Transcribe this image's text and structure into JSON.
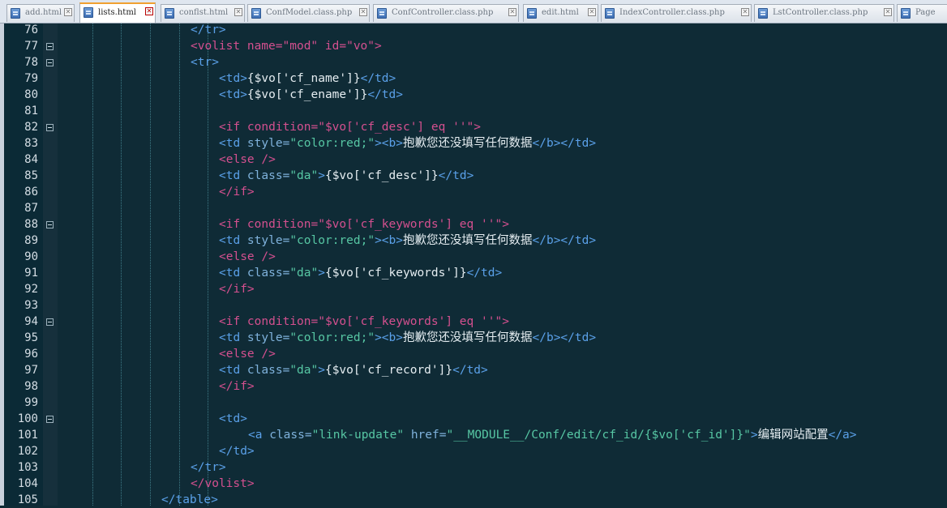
{
  "tabs": [
    {
      "label": "add.html",
      "active": false
    },
    {
      "label": "lists.html",
      "active": true
    },
    {
      "label": "conflst.html",
      "active": false
    },
    {
      "label": "ConfModel.class.php",
      "active": false
    },
    {
      "label": "ConfController.class.php",
      "active": false
    },
    {
      "label": "edit.html",
      "active": false
    },
    {
      "label": "IndexController.class.php",
      "active": false
    },
    {
      "label": "LstController.class.php",
      "active": false
    },
    {
      "label": "Page",
      "active": false
    }
  ],
  "tab_close_glyph": "✕",
  "icons": {
    "tab_file": "html-file-icon",
    "fold": "fold-minus-icon"
  },
  "colors": {
    "editor_bg": "#0f2b36",
    "tag": "#5aa0e8",
    "special_tag": "#d4508f",
    "attribute": "#7fb2dc",
    "string": "#57c7a4",
    "text": "#e5edf1"
  },
  "code_lines": [
    {
      "n": "76",
      "fold": false,
      "indent": 6,
      "tokens": [
        [
          "tag",
          "</tr>"
        ]
      ]
    },
    {
      "n": "77",
      "fold": true,
      "indent": 6,
      "tokens": [
        [
          "special",
          "<volist "
        ],
        [
          "special",
          "name="
        ],
        [
          "special",
          "\"mod\" "
        ],
        [
          "special",
          "id="
        ],
        [
          "special",
          "\"vo\""
        ],
        [
          "special",
          ">"
        ]
      ]
    },
    {
      "n": "78",
      "fold": true,
      "indent": 6,
      "tokens": [
        [
          "tag",
          "<tr>"
        ]
      ]
    },
    {
      "n": "79",
      "fold": false,
      "indent": 7,
      "tokens": [
        [
          "tag",
          "<td>"
        ],
        [
          "text",
          "{$vo['cf_name']}"
        ],
        [
          "tag",
          "</td>"
        ]
      ]
    },
    {
      "n": "80",
      "fold": false,
      "indent": 7,
      "tokens": [
        [
          "tag",
          "<td>"
        ],
        [
          "text",
          "{$vo['cf_ename']}"
        ],
        [
          "tag",
          "</td>"
        ]
      ]
    },
    {
      "n": "81",
      "fold": false,
      "indent": 0,
      "tokens": []
    },
    {
      "n": "82",
      "fold": true,
      "indent": 7,
      "tokens": [
        [
          "special",
          "<if condition=\"$vo['cf_desc'] eq ''\">"
        ]
      ]
    },
    {
      "n": "83",
      "fold": false,
      "indent": 7,
      "tokens": [
        [
          "tag",
          "<td "
        ],
        [
          "attr",
          "style="
        ],
        [
          "str",
          "\"color:red;\""
        ],
        [
          "tag",
          "><b>"
        ],
        [
          "text",
          "抱歉您还没填写任何数据"
        ],
        [
          "tag",
          "</b></td>"
        ]
      ]
    },
    {
      "n": "84",
      "fold": false,
      "indent": 7,
      "tokens": [
        [
          "special",
          "<else />"
        ]
      ]
    },
    {
      "n": "85",
      "fold": false,
      "indent": 7,
      "tokens": [
        [
          "tag",
          "<td "
        ],
        [
          "attr",
          "class="
        ],
        [
          "str",
          "\"da\""
        ],
        [
          "tag",
          ">"
        ],
        [
          "text",
          "{$vo['cf_desc']}"
        ],
        [
          "tag",
          "</td>"
        ]
      ]
    },
    {
      "n": "86",
      "fold": false,
      "indent": 7,
      "tokens": [
        [
          "special",
          "</if>"
        ]
      ]
    },
    {
      "n": "87",
      "fold": false,
      "indent": 0,
      "tokens": []
    },
    {
      "n": "88",
      "fold": true,
      "indent": 7,
      "tokens": [
        [
          "special",
          "<if condition=\"$vo['cf_keywords'] eq ''\">"
        ]
      ]
    },
    {
      "n": "89",
      "fold": false,
      "indent": 7,
      "tokens": [
        [
          "tag",
          "<td "
        ],
        [
          "attr",
          "style="
        ],
        [
          "str",
          "\"color:red;\""
        ],
        [
          "tag",
          "><b>"
        ],
        [
          "text",
          "抱歉您还没填写任何数据"
        ],
        [
          "tag",
          "</b></td>"
        ]
      ]
    },
    {
      "n": "90",
      "fold": false,
      "indent": 7,
      "tokens": [
        [
          "special",
          "<else />"
        ]
      ]
    },
    {
      "n": "91",
      "fold": false,
      "indent": 7,
      "tokens": [
        [
          "tag",
          "<td "
        ],
        [
          "attr",
          "class="
        ],
        [
          "str",
          "\"da\""
        ],
        [
          "tag",
          ">"
        ],
        [
          "text",
          "{$vo['cf_keywords']}"
        ],
        [
          "tag",
          "</td>"
        ]
      ]
    },
    {
      "n": "92",
      "fold": false,
      "indent": 7,
      "tokens": [
        [
          "special",
          "</if>"
        ]
      ]
    },
    {
      "n": "93",
      "fold": false,
      "indent": 0,
      "tokens": []
    },
    {
      "n": "94",
      "fold": true,
      "indent": 7,
      "tokens": [
        [
          "special",
          "<if condition=\"$vo['cf_keywords'] eq ''\">"
        ]
      ]
    },
    {
      "n": "95",
      "fold": false,
      "indent": 7,
      "tokens": [
        [
          "tag",
          "<td "
        ],
        [
          "attr",
          "style="
        ],
        [
          "str",
          "\"color:red;\""
        ],
        [
          "tag",
          "><b>"
        ],
        [
          "text",
          "抱歉您还没填写任何数据"
        ],
        [
          "tag",
          "</b></td>"
        ]
      ]
    },
    {
      "n": "96",
      "fold": false,
      "indent": 7,
      "tokens": [
        [
          "special",
          "<else />"
        ]
      ]
    },
    {
      "n": "97",
      "fold": false,
      "indent": 7,
      "tokens": [
        [
          "tag",
          "<td "
        ],
        [
          "attr",
          "class="
        ],
        [
          "str",
          "\"da\""
        ],
        [
          "tag",
          ">"
        ],
        [
          "text",
          "{$vo['cf_record']}"
        ],
        [
          "tag",
          "</td>"
        ]
      ]
    },
    {
      "n": "98",
      "fold": false,
      "indent": 7,
      "tokens": [
        [
          "special",
          "</if>"
        ]
      ]
    },
    {
      "n": "99",
      "fold": false,
      "indent": 0,
      "tokens": []
    },
    {
      "n": "100",
      "fold": true,
      "indent": 7,
      "tokens": [
        [
          "tag",
          "<td>"
        ]
      ]
    },
    {
      "n": "101",
      "fold": false,
      "indent": 8,
      "tokens": [
        [
          "tag",
          "<a "
        ],
        [
          "attr",
          "class="
        ],
        [
          "str",
          "\"link-update\" "
        ],
        [
          "attr",
          "href="
        ],
        [
          "str",
          "\"__MODULE__/Conf/edit/cf_id/{$vo['cf_id']}\""
        ],
        [
          "tag",
          ">"
        ],
        [
          "text",
          "编辑网站配置"
        ],
        [
          "tag",
          "</a>"
        ]
      ]
    },
    {
      "n": "102",
      "fold": false,
      "indent": 7,
      "tokens": [
        [
          "tag",
          "</td>"
        ]
      ]
    },
    {
      "n": "103",
      "fold": false,
      "indent": 6,
      "tokens": [
        [
          "tag",
          "</tr>"
        ]
      ]
    },
    {
      "n": "104",
      "fold": false,
      "indent": 6,
      "tokens": [
        [
          "special",
          "</volist>"
        ]
      ]
    },
    {
      "n": "105",
      "fold": false,
      "indent": 5,
      "tokens": [
        [
          "tag",
          "</table>"
        ]
      ]
    }
  ]
}
